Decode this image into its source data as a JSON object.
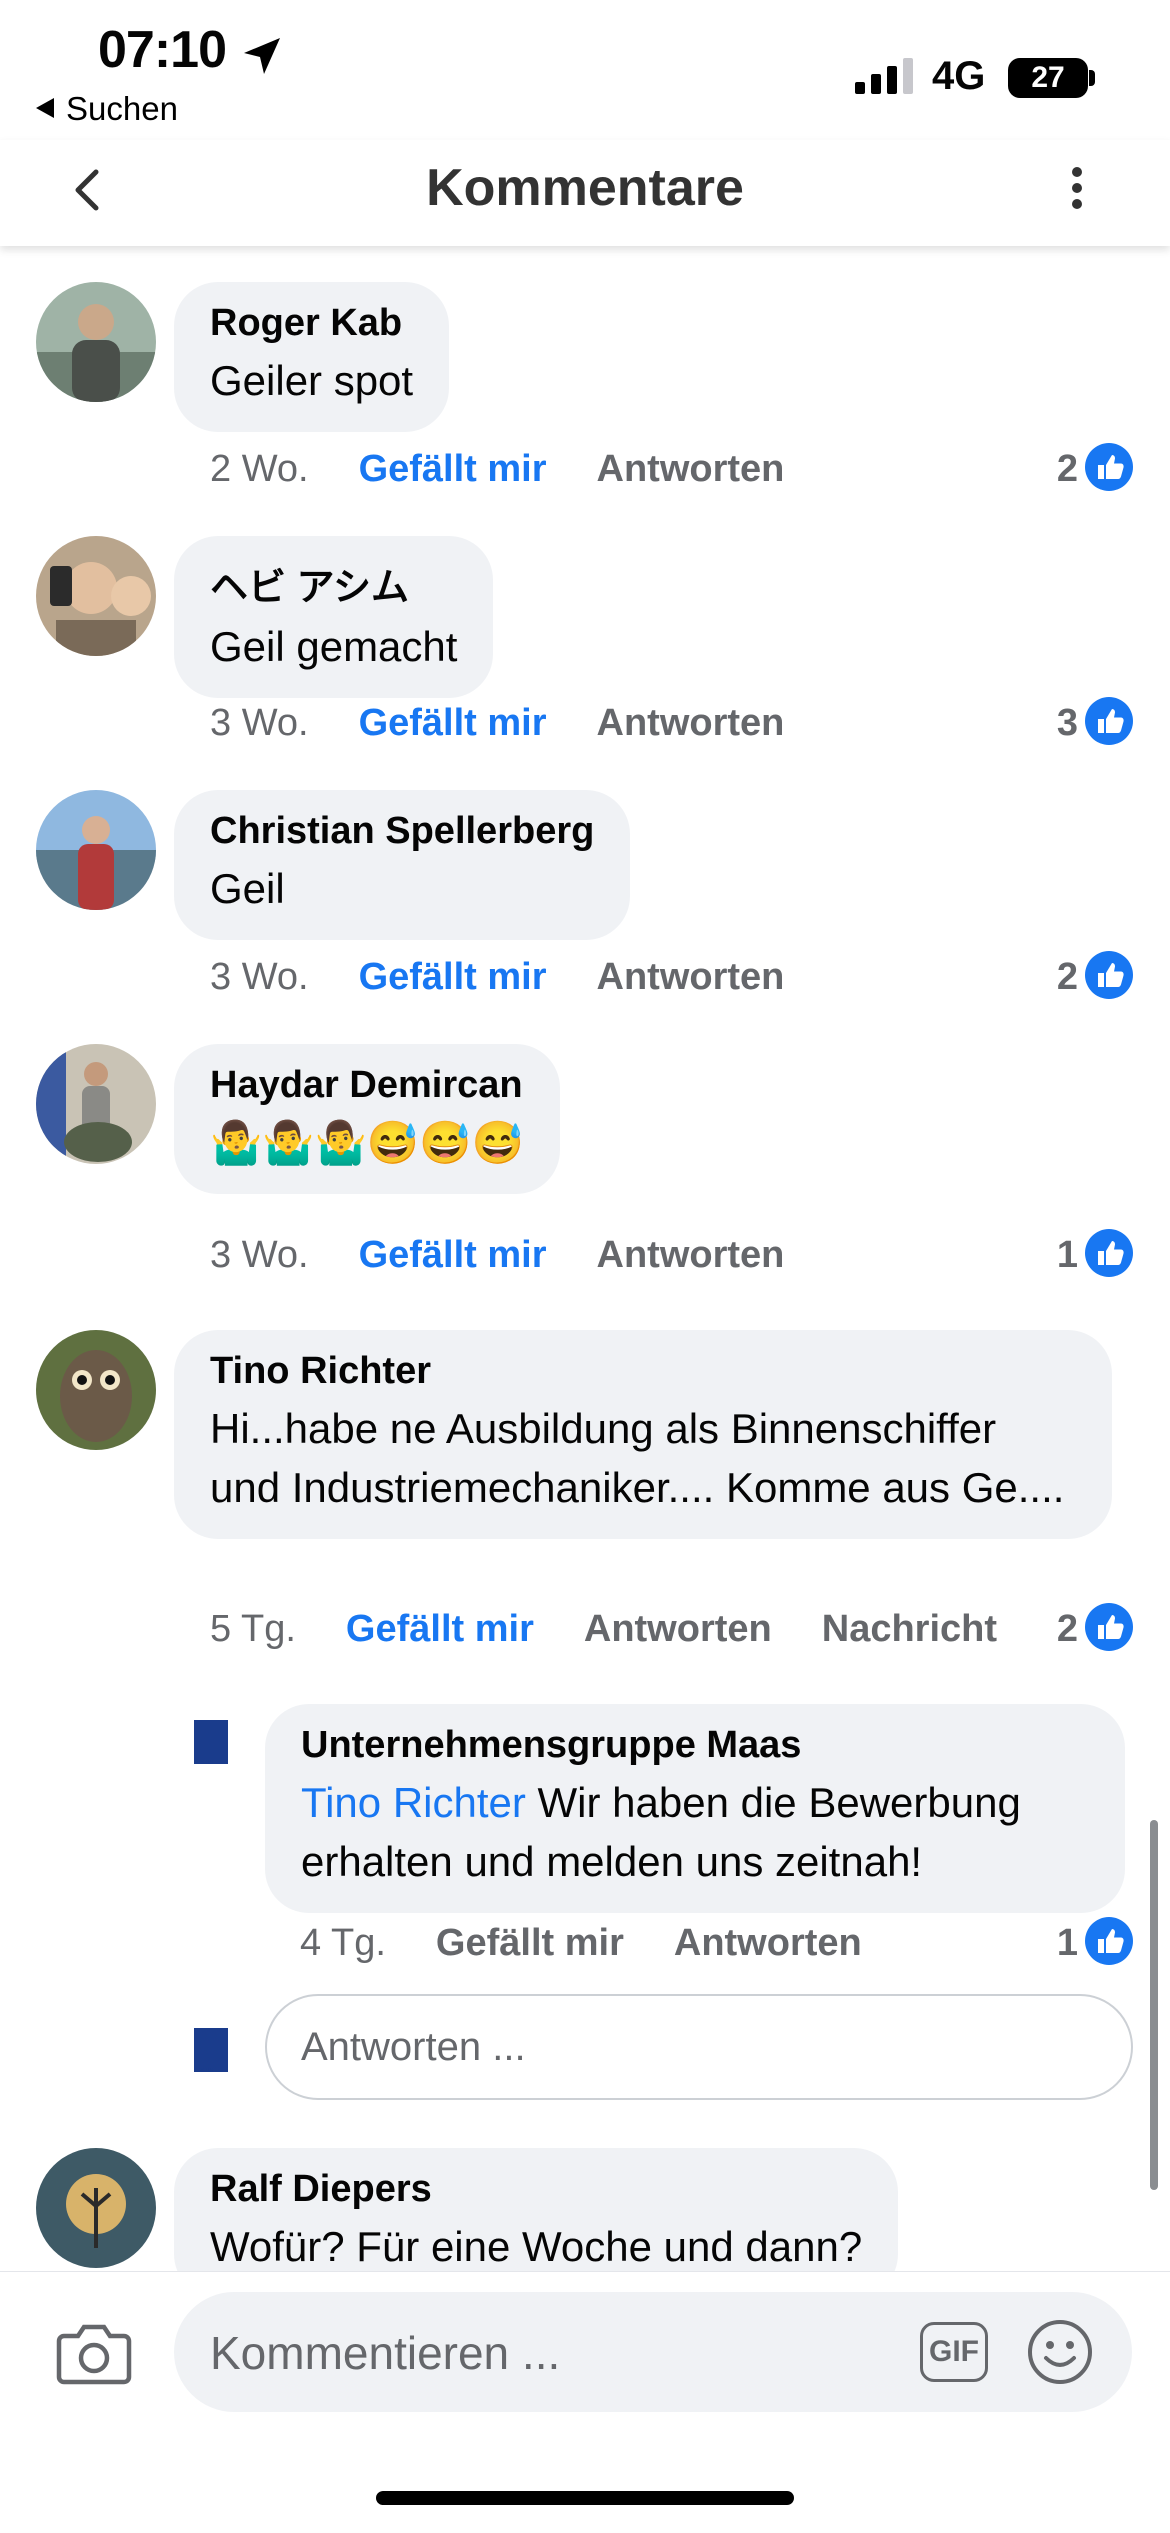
{
  "status_bar": {
    "time": "07:10",
    "back_app": "Suchen",
    "network": "4G",
    "battery": "27"
  },
  "header": {
    "title": "Kommentare"
  },
  "actions": {
    "like": "Gefällt mir",
    "reply": "Antworten",
    "message": "Nachricht"
  },
  "comments": [
    {
      "author": "Roger Kab",
      "text": "Geiler spot",
      "age": "2 Wo.",
      "likes": "2"
    },
    {
      "author": "ヘビ アシム",
      "text": "Geil gemacht",
      "age": "3 Wo.",
      "likes": "3"
    },
    {
      "author": "Christian Spellerberg",
      "text": "Geil",
      "age": "3 Wo.",
      "likes": "2"
    },
    {
      "author": "Haydar Demircan",
      "text": "🤷‍♂️🤷‍♂️🤷‍♂️😅😅😅",
      "age": "3 Wo.",
      "likes": "1"
    },
    {
      "author": "Tino Richter",
      "text": "Hi...habe ne Ausbildung als Binnenschiffer und Industriemechaniker.... Komme aus Ge....",
      "age": "5 Tg.",
      "likes": "2"
    },
    {
      "author": "Ralf Diepers",
      "text": "Wofür? Für eine Woche und dann?"
    }
  ],
  "reply": {
    "author": "Unternehmensgruppe Maas",
    "mention": "Tino Richter",
    "text": " Wir haben die Bewerbung erhalten und melden uns zeitnah!",
    "age": "4 Tg.",
    "likes": "1"
  },
  "reply_input": {
    "placeholder": "Antworten ..."
  },
  "composer": {
    "placeholder": "Kommentieren ...",
    "gif_label": "GIF"
  },
  "colors": {
    "accent": "#1877f2",
    "bubble": "#f0f2f5",
    "secondary_text": "#65676b"
  }
}
